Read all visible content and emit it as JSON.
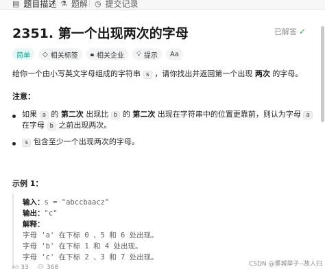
{
  "tabs": [
    {
      "icon": "document-icon",
      "label": "题目描述"
    },
    {
      "icon": "flask-icon",
      "label": "题解"
    },
    {
      "icon": "clock-icon",
      "label": "提交记录"
    }
  ],
  "problem": {
    "title": "2351. 第一个出现两次的字母",
    "status": "已解答",
    "tags": [
      "简单",
      "相关标签",
      "相关企业",
      "提示",
      "Aa"
    ]
  },
  "description": {
    "intro_pre": "给你一个由小写英文字母组成的字符串",
    "intro_code": "s",
    "intro_mid": "，请你找出并返回第一个出现",
    "intro_bold": "两次",
    "intro_post": "的字母。",
    "note_title": "注意：",
    "note1_a": "如果",
    "note1_code_a": "a",
    "note1_b": "的",
    "note1_bold1": "第二次",
    "note1_c": "出现比",
    "note1_code_b": "b",
    "note1_d": "的",
    "note1_bold2": "第二次",
    "note1_e": "出现在字符串中的位置更靠前，则认为字母",
    "note1_code_c": "a",
    "note1_line2_a": "在字母",
    "note1_code_d": "b",
    "note1_line2_b": "之前出现两次。",
    "note2_code": "s",
    "note2_text": "包含至少一个出现两次的字母。"
  },
  "example": {
    "title": "示例 1：",
    "input_label": "输入：",
    "input_value": "s = \"abccbaacz\"",
    "output_label": "输出：",
    "output_value": "\"c\"",
    "explain_label": "解释：",
    "lines": [
      "字母 'a' 在下标 0 、5 和 6 处出现。",
      "字母 'b' 在下标 1 和 4 处出现。",
      "字母 'c' 在下标 2 、3 和 7 处出现。"
    ]
  },
  "footer": {
    "likes": "33",
    "views": "368"
  },
  "watermark": "CSDN @墨城举子--故人归"
}
